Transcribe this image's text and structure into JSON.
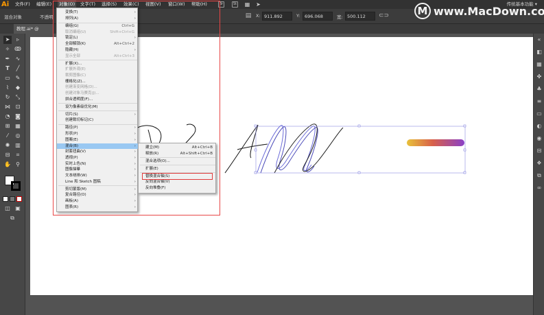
{
  "app": {
    "logo": "Ai",
    "workspace": "传统基本功能 ▾"
  },
  "menubar": {
    "items": [
      "文件(F)",
      "编辑(E)",
      "对象(O)",
      "文字(T)",
      "选择(S)",
      "效果(C)",
      "视图(V)",
      "窗口(W)",
      "帮助(H)"
    ],
    "active": "对象(O)",
    "icon_labels": [
      "Br",
      "St"
    ]
  },
  "controlbar": {
    "selection_label": "混合对象",
    "opacity_label": "不透明",
    "x_label": "X:",
    "x_value": "911.892",
    "y_label": "Y:",
    "y_value": "696.068",
    "w_label": "宽:",
    "w_value": "500.112"
  },
  "document_tab": {
    "label": "教程.ai* @"
  },
  "object_menu": {
    "items": [
      {
        "label": "变换(T)",
        "shortcut": "",
        "submenu": true,
        "disabled": false
      },
      {
        "label": "排列(A)",
        "shortcut": "",
        "submenu": true,
        "disabled": false
      },
      {
        "label": "编组(G)",
        "shortcut": "Ctrl+G",
        "submenu": false,
        "disabled": false
      },
      {
        "label": "取消编组(U)",
        "shortcut": "Shift+Ctrl+G",
        "submenu": false,
        "disabled": true
      },
      {
        "label": "锁定(L)",
        "shortcut": "",
        "submenu": true,
        "disabled": false
      },
      {
        "label": "全部解锁(K)",
        "shortcut": "Alt+Ctrl+2",
        "submenu": false,
        "disabled": false
      },
      {
        "label": "隐藏(H)",
        "shortcut": "",
        "submenu": true,
        "disabled": false
      },
      {
        "label": "显示全部",
        "shortcut": "Alt+Ctrl+3",
        "submenu": false,
        "disabled": true
      },
      {
        "label": "扩展(X)...",
        "shortcut": "",
        "submenu": false,
        "disabled": false
      },
      {
        "label": "扩展外观(E)",
        "shortcut": "",
        "submenu": false,
        "disabled": true
      },
      {
        "label": "裁剪图像(C)",
        "shortcut": "",
        "submenu": false,
        "disabled": true
      },
      {
        "label": "栅格化(Z)...",
        "shortcut": "",
        "submenu": false,
        "disabled": false
      },
      {
        "label": "创建渐变网格(D)...",
        "shortcut": "",
        "submenu": false,
        "disabled": true
      },
      {
        "label": "创建对象马赛克(J)...",
        "shortcut": "",
        "submenu": false,
        "disabled": true
      },
      {
        "label": "拼合透明度(F)...",
        "shortcut": "",
        "submenu": false,
        "disabled": false
      },
      {
        "label": "设为像素级优化(M)",
        "shortcut": "",
        "submenu": false,
        "disabled": false
      },
      {
        "label": "切片(S)",
        "shortcut": "",
        "submenu": true,
        "disabled": false
      },
      {
        "label": "创建裁切标记(C)",
        "shortcut": "",
        "submenu": false,
        "disabled": false
      },
      {
        "label": "路径(P)",
        "shortcut": "",
        "submenu": true,
        "disabled": false
      },
      {
        "label": "形状(P)",
        "shortcut": "",
        "submenu": true,
        "disabled": false
      },
      {
        "label": "图案(E)",
        "shortcut": "",
        "submenu": true,
        "disabled": false
      },
      {
        "label": "混合(B)",
        "shortcut": "",
        "submenu": true,
        "disabled": false,
        "highlighted": true
      },
      {
        "label": "封套扭曲(V)",
        "shortcut": "",
        "submenu": true,
        "disabled": false
      },
      {
        "label": "透视(P)",
        "shortcut": "",
        "submenu": true,
        "disabled": false
      },
      {
        "label": "实时上色(N)",
        "shortcut": "",
        "submenu": true,
        "disabled": false
      },
      {
        "label": "图像描摹",
        "shortcut": "",
        "submenu": true,
        "disabled": false
      },
      {
        "label": "文本绕排(W)",
        "shortcut": "",
        "submenu": true,
        "disabled": false
      },
      {
        "label": "Line 和 Sketch 图稿",
        "shortcut": "",
        "submenu": true,
        "disabled": false
      },
      {
        "label": "剪切蒙版(M)",
        "shortcut": "",
        "submenu": true,
        "disabled": false
      },
      {
        "label": "复合路径(O)",
        "shortcut": "",
        "submenu": true,
        "disabled": false
      },
      {
        "label": "画板(A)",
        "shortcut": "",
        "submenu": true,
        "disabled": false
      },
      {
        "label": "图表(R)",
        "shortcut": "",
        "submenu": true,
        "disabled": false
      }
    ]
  },
  "blend_submenu": {
    "items": [
      {
        "label": "建立(M)",
        "shortcut": "Alt+Ctrl+B"
      },
      {
        "label": "释放(R)",
        "shortcut": "Alt+Shift+Ctrl+B"
      },
      {
        "label": "混合选项(O)...",
        "shortcut": ""
      },
      {
        "label": "扩展(E)",
        "shortcut": ""
      },
      {
        "label": "替换混合轴(S)",
        "shortcut": "",
        "annotated": true
      },
      {
        "label": "反向混合轴(V)",
        "shortcut": ""
      },
      {
        "label": "反向堆叠(F)",
        "shortcut": ""
      }
    ]
  },
  "watermark": {
    "text": "www.MacDown.com",
    "logo_letter": "M"
  },
  "colors": {
    "annotation_red": "#e84646",
    "menu_highlight": "#99c8f2",
    "gradient_start": "#e8c13a",
    "gradient_mid": "#d8604a",
    "gradient_end": "#8a40c8"
  }
}
